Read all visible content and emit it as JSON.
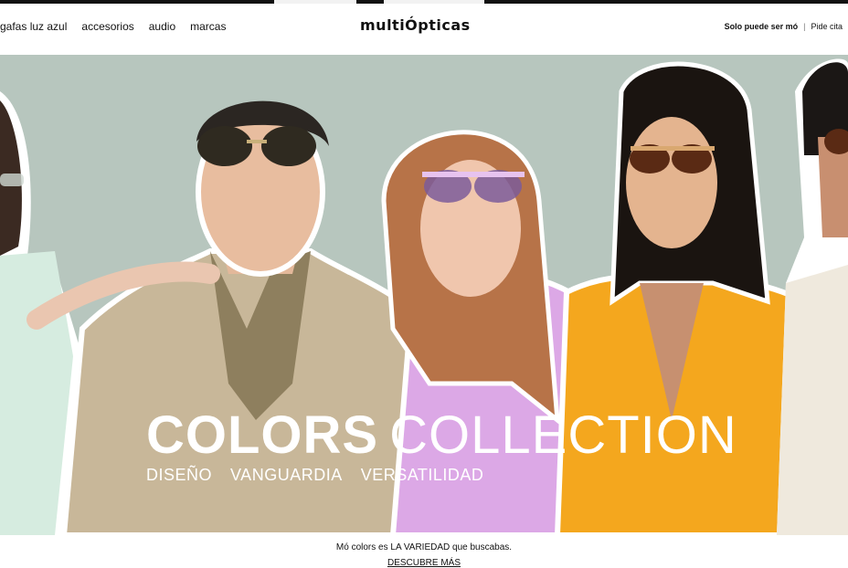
{
  "nav": {
    "items": [
      "gafas luz azul",
      "accesorios",
      "audio",
      "marcas"
    ]
  },
  "brand": {
    "logo_text": "multiÓpticas"
  },
  "utility": {
    "promo": "Solo puede ser mó",
    "separator": "|",
    "appointment": "Pide cita"
  },
  "hero": {
    "title_bold": "COLORS",
    "title_light": "COLLECTION",
    "subtitle": [
      "DISEÑO",
      "VANGUARDIA",
      "VERSATILIDAD"
    ],
    "background_color": "#b7c6be"
  },
  "footer": {
    "tagline": "Mó colors es LA VARIEDAD que buscabas.",
    "cta": "DESCUBRE MÁS"
  }
}
